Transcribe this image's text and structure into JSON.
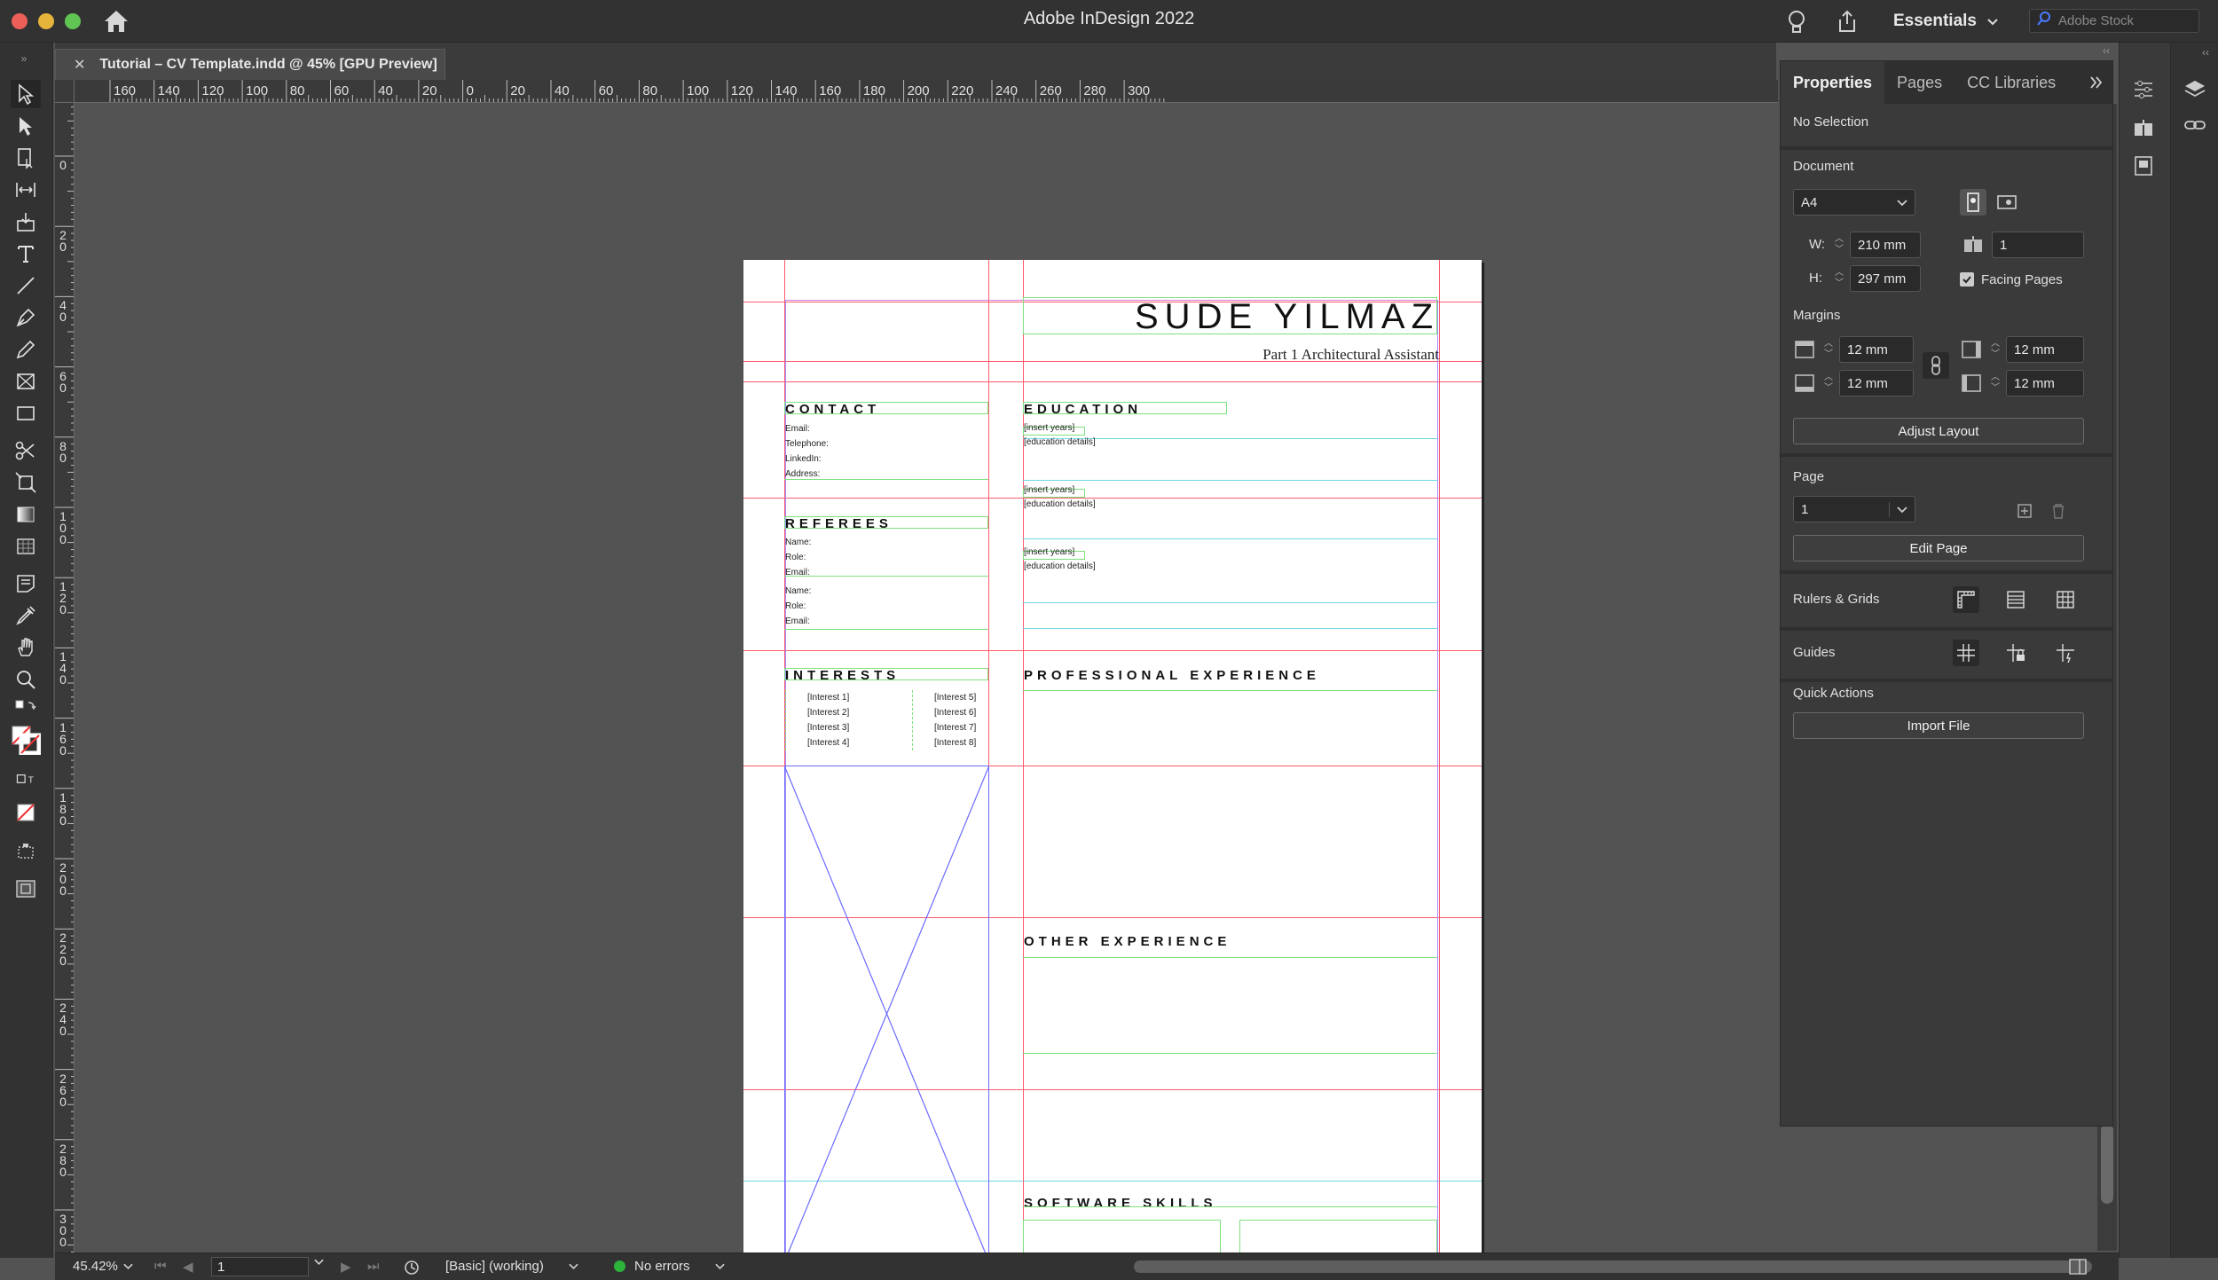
{
  "window": {
    "app_title": "Adobe InDesign 2022",
    "workspace": "Essentials",
    "stock_placeholder": "Adobe Stock"
  },
  "document_tab": {
    "title": "Tutorial – CV Template.indd @ 45% [GPU Preview]"
  },
  "ruler": {
    "h_labels": [
      "160",
      "140",
      "120",
      "100",
      "80",
      "60",
      "40",
      "20",
      "0",
      "20",
      "40",
      "60",
      "80",
      "100",
      "120",
      "140",
      "160",
      "180",
      "200",
      "220",
      "240",
      "260",
      "280",
      "300"
    ],
    "v_labels": [
      "0",
      "2 0",
      "4 0",
      "6 0",
      "8 0",
      "1 0 0",
      "1 2 0",
      "1 4 0",
      "1 6 0",
      "1 8 0",
      "2 0 0",
      "2 2 0",
      "2 4 0",
      "2 6 0",
      "2 8 0",
      "3 0 0"
    ]
  },
  "cv": {
    "name": "SUDE YILMAZ",
    "role": "Part 1 Architectural Assistant",
    "contact_heading": "CONTACT",
    "contact_lines": [
      "Email:",
      "Telephone:",
      "LinkedIn:",
      "Address:"
    ],
    "referees_heading": "REFEREES",
    "referee1_lines": [
      "Name:",
      "Role:",
      "Email:"
    ],
    "referee2_lines": [
      "Name:",
      "Role:",
      "Email:"
    ],
    "interests_heading": "INTERESTS",
    "interests_left": [
      "[Interest 1]",
      "[Interest 2]",
      "[Interest 3]",
      "[Interest 4]"
    ],
    "interests_right": [
      "[Interest 5]",
      "[Interest 6]",
      "[Interest 7]",
      "[Interest 8]"
    ],
    "education_heading": "EDUCATION",
    "education_entries": [
      {
        "years": "[insert years]",
        "details": "[education details]"
      },
      {
        "years": "[insert years]",
        "details": "[education details]"
      },
      {
        "years": "[insert years]",
        "details": "[education details]"
      }
    ],
    "professional_heading": "PROFESSIONAL EXPERIENCE",
    "other_heading": "OTHER EXPERIENCE",
    "software_heading": "SOFTWARE SKILLS"
  },
  "properties": {
    "tabs": [
      "Properties",
      "Pages",
      "CC Libraries"
    ],
    "selection": "No Selection",
    "document_label": "Document",
    "page_size": "A4",
    "width_label": "W:",
    "width": "210 mm",
    "height_label": "H:",
    "height": "297 mm",
    "pages_count": "1",
    "facing_pages_label": "Facing Pages",
    "facing_pages_checked": true,
    "margins_label": "Margins",
    "margin_top": "12 mm",
    "margin_bottom": "12 mm",
    "margin_left": "12 mm",
    "margin_right": "12 mm",
    "adjust_layout": "Adjust Layout",
    "page_label": "Page",
    "page_value": "1",
    "edit_page": "Edit Page",
    "rulers_grids_label": "Rulers & Grids",
    "guides_label": "Guides",
    "quick_actions_label": "Quick Actions",
    "import_file": "Import File"
  },
  "status": {
    "zoom": "45.42%",
    "page": "1",
    "style": "[Basic] (working)",
    "preflight": "No errors"
  }
}
